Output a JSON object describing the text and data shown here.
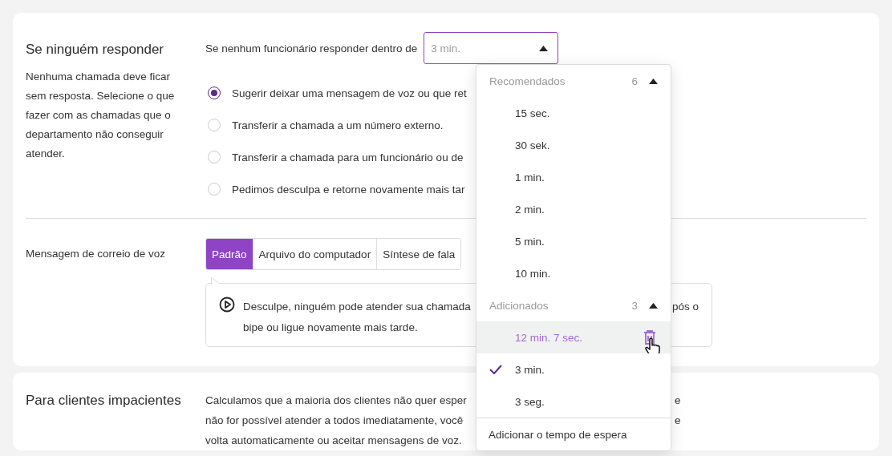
{
  "section": {
    "title": "Se ninguém responder",
    "description": "Nenhuma chamada deve ficar sem resposta. Selecione o que fazer com as chamadas que o departamento não conseguir atender.",
    "timeout_label": "Se nenhum funcionário responder dentro de",
    "timeout_select": {
      "value": "3 min.",
      "expanded": true
    },
    "options": [
      {
        "label": "Sugerir deixar uma mensagem de voz ou que ret",
        "selected": true
      },
      {
        "label": "Transferir a chamada a um número externo.",
        "selected": false
      },
      {
        "label": "Transferir a chamada para um funcionário ou de",
        "selected": false
      },
      {
        "label": "Pedimos desculpa e retorne novamente mais tar",
        "selected": false
      }
    ],
    "voicemail": {
      "label": "Mensagem de correio de voz",
      "tabs": [
        {
          "label": "Padrão",
          "selected": true
        },
        {
          "label": "Arquivo do computador",
          "selected": false
        },
        {
          "label": "Síntese de fala",
          "selected": false
        }
      ],
      "message_lines": [
        {
          "text": "Desculpe, ninguém pode atender sua chamada",
          "tail": "pós o"
        },
        {
          "text": "bipe ou ligue novamente mais tarde."
        }
      ]
    }
  },
  "impatient": {
    "title": "Para clientes impacientes",
    "lines": [
      {
        "text": "Calculamos que a maioria dos clientes não quer esper",
        "tail": "e"
      },
      {
        "text": "não for possível atender a todos imediatamente, você",
        "tail": "e"
      },
      {
        "text": "volta automaticamente ou aceitar mensagens de voz."
      }
    ]
  },
  "dropdown": {
    "groups": [
      {
        "title": "Recomendados",
        "count": "6",
        "expanded": true,
        "items": [
          {
            "label": "15 sec.",
            "selected": false,
            "hovered": false
          },
          {
            "label": "30 sek.",
            "selected": false,
            "hovered": false
          },
          {
            "label": "1 min.",
            "selected": false,
            "hovered": false
          },
          {
            "label": "2 min.",
            "selected": false,
            "hovered": false
          },
          {
            "label": "5 min.",
            "selected": false,
            "hovered": false
          },
          {
            "label": "10 min.",
            "selected": false,
            "hovered": false
          }
        ]
      },
      {
        "title": "Adicionados",
        "count": "3",
        "expanded": true,
        "items": [
          {
            "label": "12 min. 7 sec.",
            "selected": false,
            "hovered": true
          },
          {
            "label": "3 min.",
            "selected": true,
            "hovered": false
          },
          {
            "label": "3 seg.",
            "selected": false,
            "hovered": false
          }
        ]
      }
    ],
    "footer": "Adicionar o tempo de espera"
  }
}
